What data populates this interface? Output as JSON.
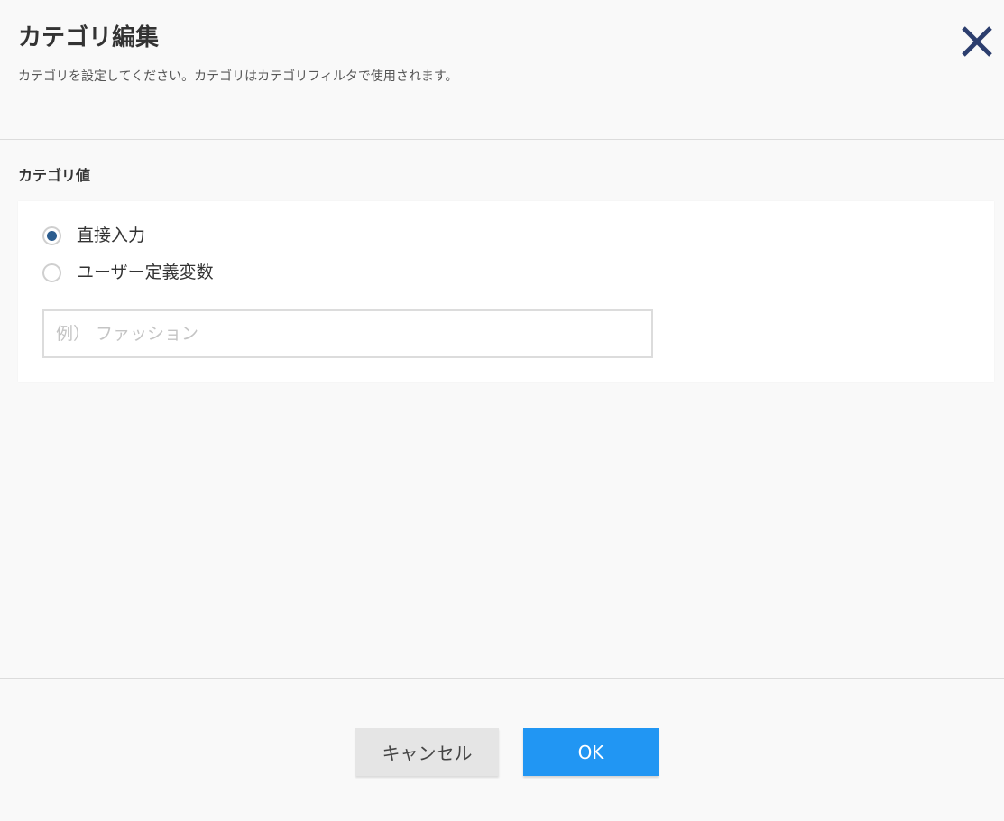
{
  "dialog": {
    "title": "カテゴリ編集",
    "description": "カテゴリを設定してください。カテゴリはカテゴリフィルタで使用されます。",
    "close_icon": "close-icon"
  },
  "category": {
    "section_label": "カテゴリ値",
    "options": [
      {
        "label": "直接入力",
        "selected": true
      },
      {
        "label": "ユーザー定義変数",
        "selected": false
      }
    ],
    "input_value": "",
    "input_placeholder": "例） ファッション"
  },
  "footer": {
    "cancel_label": "キャンセル",
    "ok_label": "OK"
  },
  "colors": {
    "primary": "#2196f3",
    "radio_checked": "#2c5d8f",
    "close_icon": "#2c3e6e"
  }
}
